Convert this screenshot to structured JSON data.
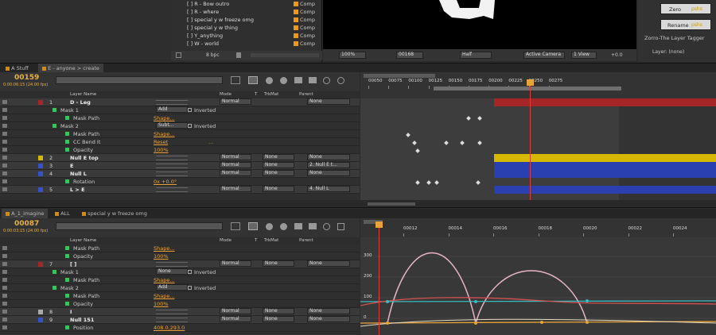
{
  "project": {
    "items": [
      {
        "name": "[ ] R - Bow outro",
        "type": "Comp"
      },
      {
        "name": "[ ] R - where",
        "type": "Comp"
      },
      {
        "name": "[ ] special y w freeze omg",
        "type": "Comp"
      },
      {
        "name": "[ ] special y w thing",
        "type": "Comp"
      },
      {
        "name": "[ ] Y_anything",
        "type": "Comp"
      },
      {
        "name": "[ ] W - world",
        "type": "Comp"
      }
    ],
    "bpc": "8 bpc"
  },
  "viewer": {
    "zoom": "100%",
    "timecode": "00168",
    "resolution": "Half",
    "camera": "Active Camera",
    "view": "1 View",
    "fit": "+0.0"
  },
  "zorro": {
    "zero": "Zero",
    "zero_tag": "pshs",
    "rename": "Rename",
    "rename_tag": "pshs",
    "title": "Zorro-The Layer Tagger",
    "layer": "Layer: (none)"
  },
  "top": {
    "tabs": [
      "A Stuff",
      "E - anyone > create"
    ],
    "timecode": "00159",
    "timecode_sub": "0:00:06:15 (24.00 fps)",
    "headers": {
      "name": "Layer Name",
      "mode": "Mode",
      "t": "T",
      "trkmat": "TrkMat",
      "parent": "Parent"
    },
    "ruler": [
      "00050",
      "00075",
      "00100",
      "00125",
      "00150",
      "00175",
      "00200",
      "00225",
      "00250",
      "00275"
    ],
    "rows": [
      {
        "num": "1",
        "name": "D - Leg",
        "mode": "Normal",
        "parent": "None"
      },
      {
        "name": "Mask 1",
        "mode": "Add",
        "inv": "Inverted"
      },
      {
        "name": "Mask Path",
        "value": "Shape..."
      },
      {
        "name": "Mask 2",
        "mode": "Subt...",
        "inv": "Inverted"
      },
      {
        "name": "Mask Path",
        "value": "Shape..."
      },
      {
        "name": "CC Bend It",
        "value": "Reset",
        "extra": "..."
      },
      {
        "name": "Opacity",
        "value": "100%"
      },
      {
        "num": "2",
        "name": "Null E top",
        "mode": "Normal",
        "trk": "None",
        "parent": "None"
      },
      {
        "num": "3",
        "name": "E",
        "mode": "Normal",
        "trk": "None",
        "parent": "2. Null E t..."
      },
      {
        "num": "4",
        "name": "Null L",
        "mode": "Normal",
        "trk": "None",
        "parent": "None"
      },
      {
        "name": "Rotation",
        "value": "0x +0.0°"
      },
      {
        "num": "5",
        "name": "L > E",
        "mode": "Normal",
        "trk": "None",
        "parent": "4. Null L"
      }
    ]
  },
  "bottom": {
    "tabs": [
      "A_1_imagine",
      "ALL",
      "special y w freeze omg"
    ],
    "timecode": "00087",
    "timecode_sub": "0:00:03:15 (24.00 fps)",
    "headers": {
      "name": "Layer Name",
      "mode": "Mode",
      "t": "T",
      "trkmat": "TrkMat",
      "parent": "Parent"
    },
    "ruler": [
      "00012",
      "00014",
      "00016",
      "00018",
      "00020",
      "00022",
      "00024"
    ],
    "graph_y": [
      "300",
      "200",
      "100",
      "0"
    ],
    "rows": [
      {
        "name": "Mask Path",
        "value": "Shape..."
      },
      {
        "name": "Opacity",
        "value": "100%"
      },
      {
        "num": "7",
        "name": "[ ]",
        "mode": "Normal",
        "trk": "None",
        "parent": "None"
      },
      {
        "name": "Mask 1",
        "mode": "None",
        "inv": "Inverted"
      },
      {
        "name": "Mask Path",
        "value": "Shape..."
      },
      {
        "name": "Mask 2",
        "mode": "Add",
        "inv": "Inverted"
      },
      {
        "name": "Mask Path",
        "value": "Shape..."
      },
      {
        "name": "Opacity",
        "value": "100%"
      },
      {
        "num": "8",
        "name": "I",
        "mode": "Normal",
        "trk": "None",
        "parent": "None"
      },
      {
        "num": "9",
        "name": "Null 151",
        "mode": "Normal",
        "trk": "None",
        "parent": "None"
      },
      {
        "name": "Position",
        "value": "408.0,293.0"
      }
    ]
  },
  "colors": {
    "red": "#a52626",
    "yellow": "#d6b800",
    "blue": "#2a3fb0",
    "orange": "#e8a33a",
    "pink": "#e7b5c9",
    "cyan": "#38bcc0",
    "salmon": "#d45050"
  }
}
